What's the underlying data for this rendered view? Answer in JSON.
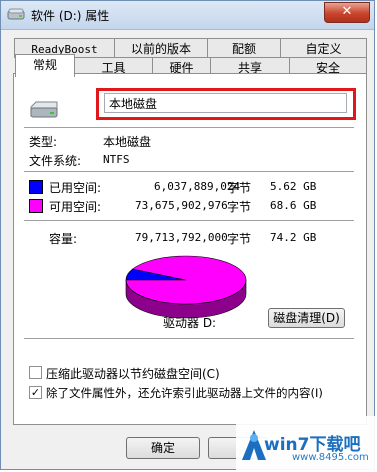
{
  "window": {
    "title": "软件 (D:) 属性",
    "close_glyph": "✕"
  },
  "tabs_row1": [
    {
      "label": "ReadyBoost"
    },
    {
      "label": "以前的版本"
    },
    {
      "label": "配额"
    },
    {
      "label": "自定义"
    }
  ],
  "tabs_row2": [
    {
      "label": "常规",
      "active": true
    },
    {
      "label": "工具"
    },
    {
      "label": "硬件"
    },
    {
      "label": "共享"
    },
    {
      "label": "安全"
    }
  ],
  "general": {
    "drive_name_value": "本地磁盘",
    "type_label": "类型:",
    "type_value": "本地磁盘",
    "fs_label": "文件系统:",
    "fs_value": "NTFS",
    "used": {
      "label": "已用空间:",
      "bytes": "6,037,889,024",
      "unit": "字节",
      "size": "5.62 GB",
      "color": "#0000ff"
    },
    "free": {
      "label": "可用空间:",
      "bytes": "73,675,902,976",
      "unit": "字节",
      "size": "68.6 GB",
      "color": "#ff00ff"
    },
    "capacity": {
      "label": "容量:",
      "bytes": "79,713,792,000",
      "unit": "字节",
      "size": "74.2 GB"
    },
    "drive_label": "驱动器 D:",
    "cleanup_button": "磁盘清理(D)",
    "compress_checkbox": {
      "label": "压缩此驱动器以节约磁盘空间(C)",
      "checked": false
    },
    "index_checkbox": {
      "label": "除了文件属性外，还允许索引此驱动器上文件的内容(I)",
      "checked": true,
      "check_glyph": "✓"
    }
  },
  "chart_data": {
    "type": "pie",
    "title": "",
    "categories": [
      "已用空间",
      "可用空间"
    ],
    "values": [
      6037889024,
      73675902976
    ],
    "colors": [
      "#0000ff",
      "#ff00ff"
    ]
  },
  "footer": {
    "ok_button": "确定"
  },
  "watermark": {
    "brand": "win7下载吧",
    "url": "www.8495.com"
  }
}
